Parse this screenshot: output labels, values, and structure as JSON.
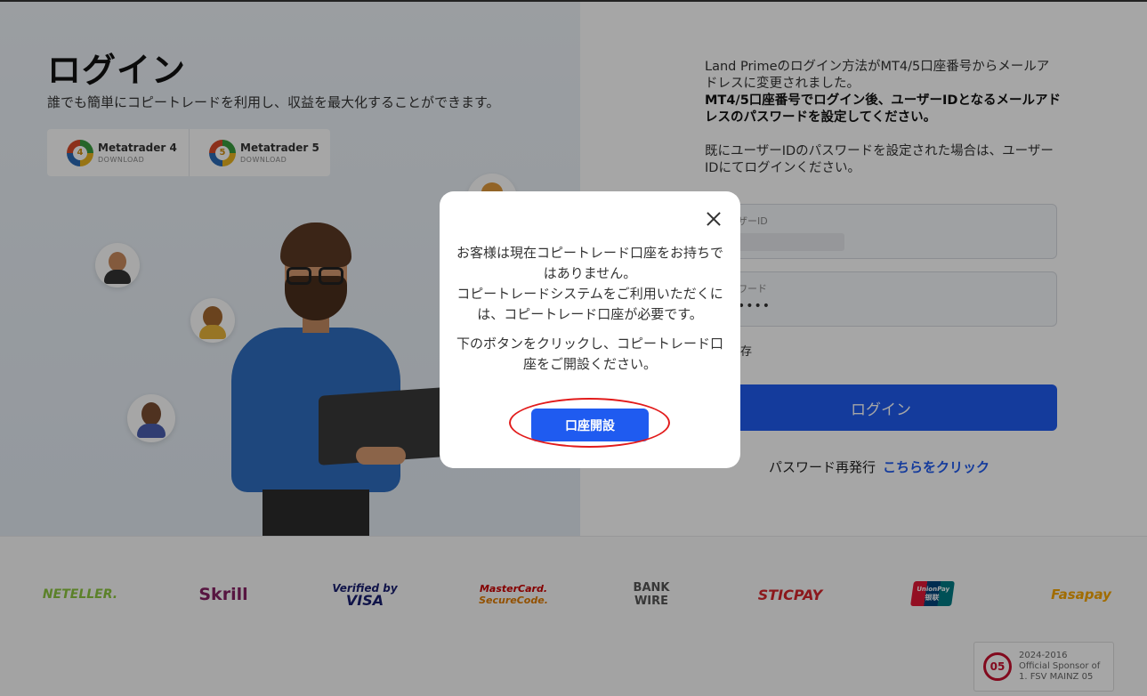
{
  "left": {
    "title": "ログイン",
    "subtitle": "誰でも簡単にコピートレードを利用し、収益を最大化することができます。",
    "platforms": [
      {
        "name": "Metatrader 4",
        "sub": "DOWNLOAD",
        "number": "4",
        "icon": "metatrader-4-icon"
      },
      {
        "name": "Metatrader 5",
        "sub": "DOWNLOAD",
        "number": "5",
        "icon": "metatrader-5-icon"
      }
    ]
  },
  "right": {
    "notice_line1": "Land Primeのログイン方法がMT4/5口座番号からメールアドレスに変更されました。",
    "notice_bold": "MT4/5口座番号でログイン後、ユーザーIDとなるメールアドレスのパスワードを設定してください。",
    "notice_line2": "既にユーザーIDのパスワードを設定された場合は、ユーザーIDにてログインください。",
    "userid_label": "ザーID",
    "password_label": "ワード",
    "password_mask": "••••",
    "remember_label": "存",
    "login_button": "ログイン",
    "reset_text": "パスワード再発行",
    "reset_link": "こちらをクリック"
  },
  "footer": {
    "payment_logos": [
      {
        "label": "NETELLER.",
        "color": "#8dc63f"
      },
      {
        "label": "Skrill",
        "color": "#862165"
      },
      {
        "label": "Verified by",
        "label2": "VISA",
        "color": "#1a1f71"
      },
      {
        "label": "MasterCard.",
        "label2": "SecureCode.",
        "color": "#cc0000"
      },
      {
        "label": "BANK",
        "label2": "WIRE",
        "color": "#555555"
      },
      {
        "label": "STICPAY",
        "color": "#d7262b"
      },
      {
        "label": "UnionPay",
        "label2": "银联",
        "color": "#e21836"
      },
      {
        "label": "Fasapay",
        "color": "#f7a600"
      }
    ],
    "sponsor": {
      "years": "2024-2016",
      "line1": "Official Sponsor of",
      "line2": "1. FSV MAINZ 05",
      "logo_text": "05"
    }
  },
  "modal": {
    "message_p1": "お客様は現在コピートレード口座をお持ちではありません。\nコピートレードシステムをご利用いただくには、コピートレード口座が必要です。",
    "message_p2": "下のボタンをクリックし、コピートレード口座をご開設ください。",
    "open_account_button": "口座開設",
    "accent_color": "#1f5bf0",
    "highlight_color": "#e21b1b"
  }
}
